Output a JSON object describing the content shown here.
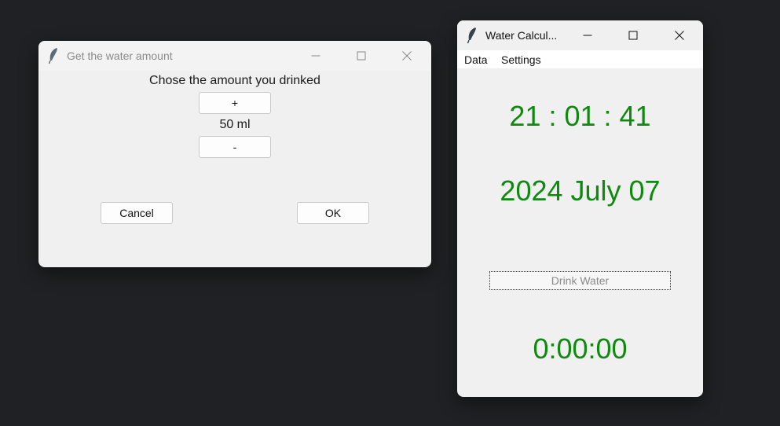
{
  "dialog": {
    "title": "Get the water amount",
    "prompt": "Chose the amount you drinked",
    "plus_label": "+",
    "amount": "50 ml",
    "minus_label": "-",
    "cancel_label": "Cancel",
    "ok_label": "OK"
  },
  "main": {
    "title": "Water Calcul...",
    "menu": [
      "Data",
      "Settings"
    ],
    "time": "21 : 01 : 41",
    "date": "2024 July 07",
    "drink_label": "Drink Water",
    "timer": "0:00:00"
  },
  "colors": {
    "clock_green": "#0f8a0f",
    "desktop": "#202124"
  }
}
